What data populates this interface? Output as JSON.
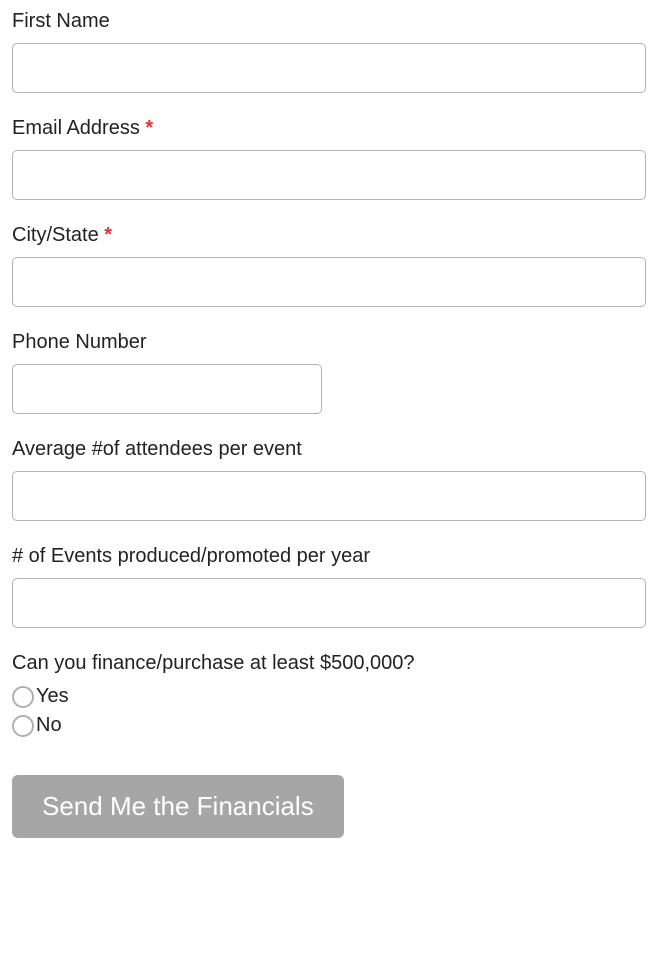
{
  "fields": {
    "first_name": {
      "label": "First Name",
      "required": false,
      "value": ""
    },
    "email": {
      "label": "Email Address",
      "required": true,
      "value": ""
    },
    "city_state": {
      "label": "City/State",
      "required": true,
      "value": ""
    },
    "phone": {
      "label": "Phone Number",
      "required": false,
      "value": ""
    },
    "avg_attendees": {
      "label": "Average #of attendees per event",
      "required": false,
      "value": ""
    },
    "events_per_year": {
      "label": "# of Events produced/promoted per year",
      "required": false,
      "value": ""
    },
    "finance_question": {
      "label": "Can you finance/purchase at least $500,000?",
      "options": {
        "yes": "Yes",
        "no": "No"
      }
    }
  },
  "required_marker": "*",
  "submit_label": "Send Me the Financials"
}
